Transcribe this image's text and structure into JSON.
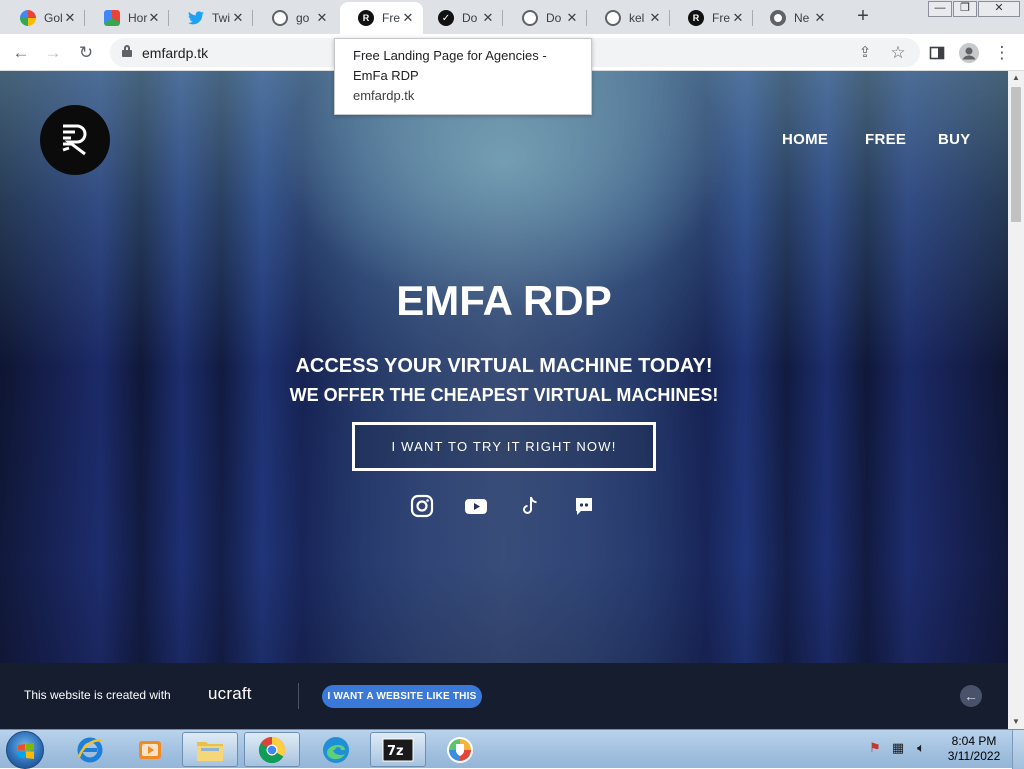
{
  "browser": {
    "tabs": [
      {
        "title": "Gol",
        "icon": "google-icon",
        "icon_color": "#4285f4",
        "active": false
      },
      {
        "title": "Hor",
        "icon": "colorful-app-icon",
        "icon_color": "#34a853",
        "active": false
      },
      {
        "title": "Twi",
        "icon": "twitter-icon",
        "icon_color": "#1da1f2",
        "active": false
      },
      {
        "title": "go",
        "icon": "globe-icon",
        "icon_color": "#5f6368",
        "active": false
      },
      {
        "title": "Fre",
        "icon": "emfa-logo-icon",
        "icon_color": "#111111",
        "active": true
      },
      {
        "title": "Do",
        "icon": "checkmark-circle-icon",
        "icon_color": "#111111",
        "active": false
      },
      {
        "title": "Do",
        "icon": "globe-icon",
        "icon_color": "#5f6368",
        "active": false
      },
      {
        "title": "kel",
        "icon": "globe-icon",
        "icon_color": "#5f6368",
        "active": false
      },
      {
        "title": "Fre",
        "icon": "emfa-logo-icon",
        "icon_color": "#111111",
        "active": false
      },
      {
        "title": "Ne",
        "icon": "chrome-icon",
        "icon_color": "#5f6368",
        "active": false
      }
    ],
    "url": "emfardp.tk",
    "tooltip": {
      "title": "Free Landing Page for Agencies - EmFa RDP",
      "url": "emfardp.tk"
    }
  },
  "site": {
    "nav": {
      "home": "HOME",
      "free": "FREE",
      "buy": "BUY"
    },
    "hero": {
      "title": "EMFA RDP",
      "subtitle_1": "ACCESS YOUR VIRTUAL MACHINE TODAY!",
      "subtitle_2": "WE OFFER THE CHEAPEST VIRTUAL MACHINES!",
      "cta": "I WANT TO TRY IT RIGHT NOW!"
    },
    "social": [
      "instagram-icon",
      "youtube-icon",
      "tiktok-icon",
      "discord-icon"
    ],
    "banner": {
      "created_text": "This website is created with",
      "brand": "ucraft",
      "button": "I WANT A WEBSITE LIKE THIS"
    }
  },
  "taskbar": {
    "apps": [
      "internet-explorer-icon",
      "media-player-icon",
      "file-explorer-icon",
      "chrome-icon",
      "edge-icon",
      "7zip-icon",
      "vpn-shield-icon"
    ],
    "time": "8:04 PM",
    "date": "3/11/2022"
  },
  "colors": {
    "banner_bg": "#161d2e",
    "banner_button": "#3a79d8",
    "taskbar": "#a6c4e2"
  }
}
